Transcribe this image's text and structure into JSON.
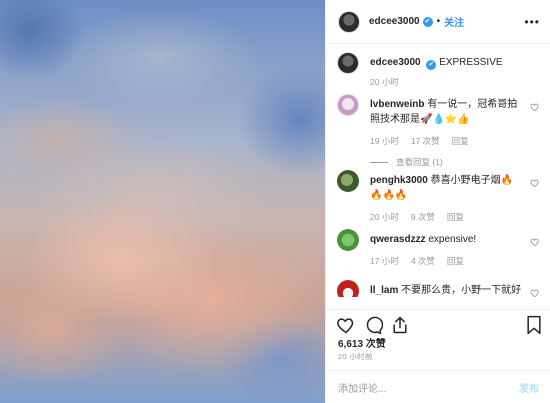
{
  "header": {
    "username": "edcee3000",
    "verified_mark": "✔",
    "separator": "•",
    "follow_label": "关注",
    "more_label": "•••",
    "more_icon": "more-horizontal-icon"
  },
  "caption": {
    "username": "edcee3000",
    "text": "EXPRESSIVE",
    "time": "20 小时"
  },
  "comments": [
    {
      "username": "lvbenweinb",
      "text": "有一说一，冠希哥拍照技术那是🚀💧⭐👍",
      "time": "19 小时",
      "likes": "17 次赞",
      "reply_label": "回复",
      "view_replies": "查看回复 (1)"
    },
    {
      "username": "penghk3000",
      "text": "恭喜小野电子烟🔥🔥🔥🔥",
      "time": "20 小时",
      "likes": "9 次赞",
      "reply_label": "回复"
    },
    {
      "username": "qwerasdzzz",
      "text": "expensive!",
      "time": "17 小时",
      "likes": "4 次赞",
      "reply_label": "回复"
    },
    {
      "username": "ll_lam",
      "text": "不要那么贵，小野一下就好",
      "time": "",
      "likes": "",
      "reply_label": ""
    }
  ],
  "actions": {
    "like_icon": "heart-icon",
    "comment_icon": "comment-icon",
    "share_icon": "share-icon",
    "save_icon": "bookmark-icon"
  },
  "likes_count": "6,613 次赞",
  "posted_ago": "20 小时前",
  "add_comment": {
    "placeholder": "添加评论...",
    "post_label": "发布"
  },
  "colors": {
    "accent": "#3897f0",
    "post_disabled": "#b2dffc",
    "muted": "#999999"
  }
}
